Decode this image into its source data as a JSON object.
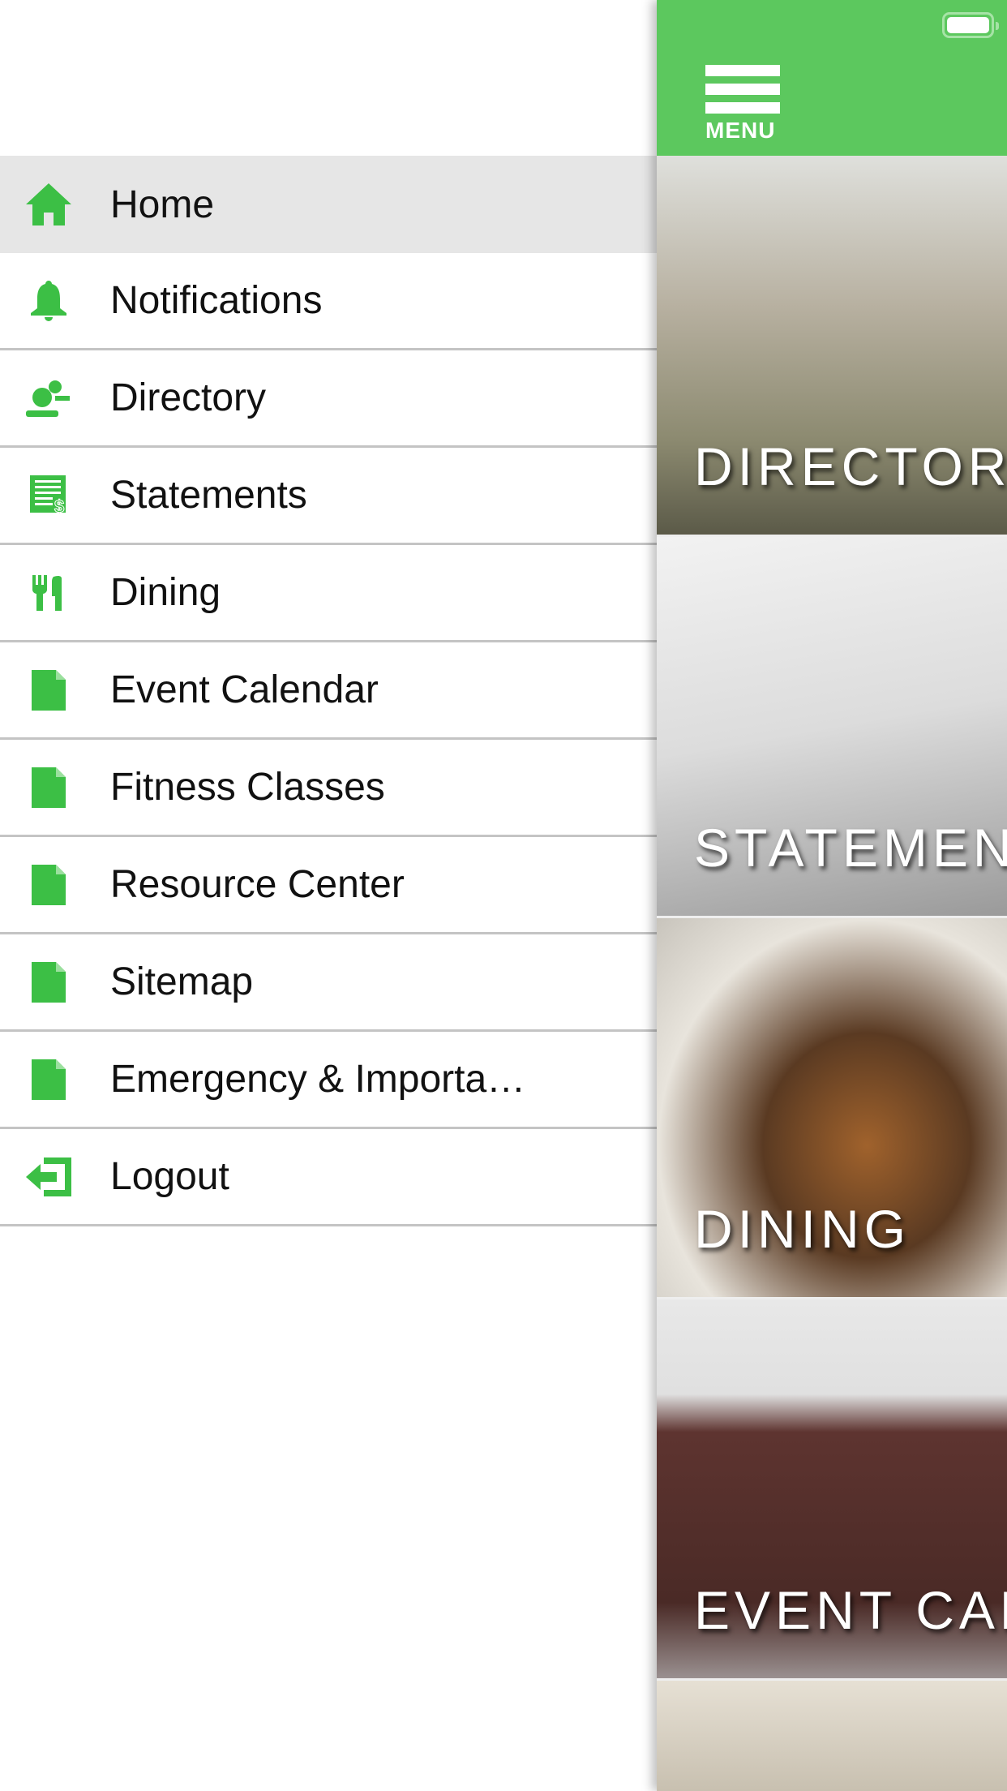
{
  "accent_color": "#5cc85e",
  "header": {
    "menu_label": "MENU",
    "menu_icon": "hamburger-icon",
    "battery_icon": "battery-icon"
  },
  "drawer": {
    "items": [
      {
        "label": "Home",
        "icon": "home-icon",
        "active": true
      },
      {
        "label": "Notifications",
        "icon": "bell-icon"
      },
      {
        "label": "Directory",
        "icon": "people-icon"
      },
      {
        "label": "Statements",
        "icon": "statement-icon"
      },
      {
        "label": "Dining",
        "icon": "fork-knife-icon"
      },
      {
        "label": "Event Calendar",
        "icon": "document-icon"
      },
      {
        "label": "Fitness Classes",
        "icon": "document-icon"
      },
      {
        "label": "Resource Center",
        "icon": "document-icon"
      },
      {
        "label": "Sitemap",
        "icon": "document-icon"
      },
      {
        "label": "Emergency & Importa…",
        "icon": "document-icon"
      },
      {
        "label": "Logout",
        "icon": "logout-icon"
      }
    ]
  },
  "tiles": [
    {
      "label": "DIRECTORY"
    },
    {
      "label": "STATEMENTS"
    },
    {
      "label": "DINING"
    },
    {
      "label": "EVENT CALENDAR"
    },
    {
      "label": ""
    }
  ]
}
